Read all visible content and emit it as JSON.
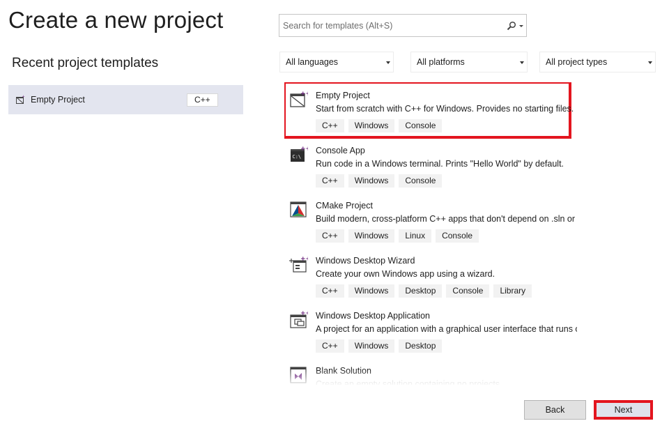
{
  "page": {
    "title": "Create a new project"
  },
  "recent": {
    "heading": "Recent project templates",
    "items": [
      {
        "label": "Empty Project",
        "tag": "C++"
      }
    ]
  },
  "search": {
    "placeholder": "Search for templates (Alt+S)",
    "value": ""
  },
  "filters": {
    "language": "All languages",
    "platform": "All platforms",
    "project_type": "All project types"
  },
  "templates": [
    {
      "name": "Empty Project",
      "description": "Start from scratch with C++ for Windows. Provides no starting files.",
      "tags": [
        "C++",
        "Windows",
        "Console"
      ],
      "icon": "empty-project-icon",
      "selected": true
    },
    {
      "name": "Console App",
      "description": "Run code in a Windows terminal. Prints \"Hello World\" by default.",
      "tags": [
        "C++",
        "Windows",
        "Console"
      ],
      "icon": "console-app-icon"
    },
    {
      "name": "CMake Project",
      "description": "Build modern, cross-platform C++ apps that don't depend on .sln or .vcxproj files.",
      "tags": [
        "C++",
        "Windows",
        "Linux",
        "Console"
      ],
      "icon": "cmake-icon"
    },
    {
      "name": "Windows Desktop Wizard",
      "description": "Create your own Windows app using a wizard.",
      "tags": [
        "C++",
        "Windows",
        "Desktop",
        "Console",
        "Library"
      ],
      "icon": "desktop-wizard-icon"
    },
    {
      "name": "Windows Desktop Application",
      "description": "A project for an application with a graphical user interface that runs on Windows.",
      "tags": [
        "C++",
        "Windows",
        "Desktop"
      ],
      "icon": "desktop-application-icon"
    },
    {
      "name": "Blank Solution",
      "description": "Create an empty solution containing no projects",
      "tags": [],
      "icon": "blank-solution-icon"
    }
  ],
  "buttons": {
    "back": "Back",
    "next": "Next"
  },
  "colors": {
    "highlight": "#e3151f",
    "accent_purple": "#68217a",
    "recent_bg": "#e3e5ef"
  }
}
